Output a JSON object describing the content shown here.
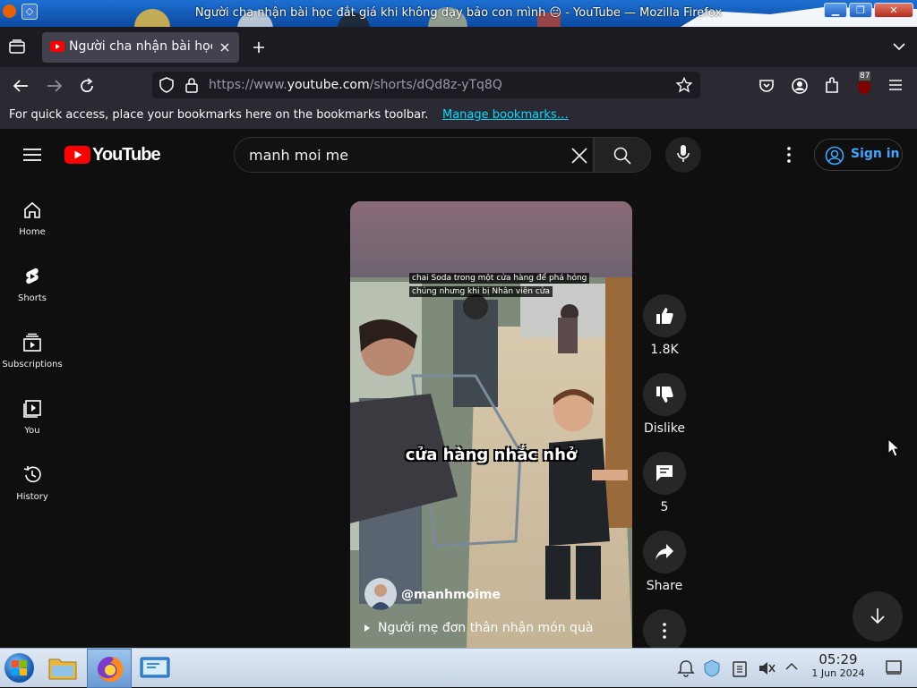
{
  "window": {
    "title": "Người cha nhận bài học đắt giá khi không dạy bảo con mình 😐 - YouTube — Mozilla Firefox",
    "controls": [
      "minimize",
      "maximize",
      "close"
    ]
  },
  "browser": {
    "tab_title": "Người cha nhận bài học",
    "url_prefix": "https://www.",
    "url_domain": "youtube.com",
    "url_path": "/shorts/dQd8z-yTq8Q",
    "extension_badge": "87",
    "bookmarks_text": "For quick access, place your bookmarks here on the bookmarks toolbar.",
    "bookmarks_link": "Manage bookmarks…"
  },
  "youtube": {
    "logo_text": "YouTube",
    "search_value": "manh moi me",
    "sign_in": "Sign in",
    "nav": [
      {
        "label": "Home",
        "icon": "home-icon"
      },
      {
        "label": "Shorts",
        "icon": "shorts-icon"
      },
      {
        "label": "Subscriptions",
        "icon": "subscriptions-icon"
      },
      {
        "label": "You",
        "icon": "you-icon"
      },
      {
        "label": "History",
        "icon": "history-icon"
      }
    ],
    "short": {
      "caption_line1": "chai Soda trong một cửa hàng để phá hỏng",
      "caption_line2": "chúng nhưng khi bị Nhân viên cửa",
      "overlay_text": "cửa hàng nhắc nhở",
      "channel": "@manhmoime",
      "description": "Người mẹ đơn thân nhận món quà"
    },
    "actions": {
      "likes": "1.8K",
      "dislike": "Dislike",
      "comments": "5",
      "share": "Share"
    }
  },
  "taskbar": {
    "time": "05:29",
    "date": "1 Jun 2024"
  }
}
